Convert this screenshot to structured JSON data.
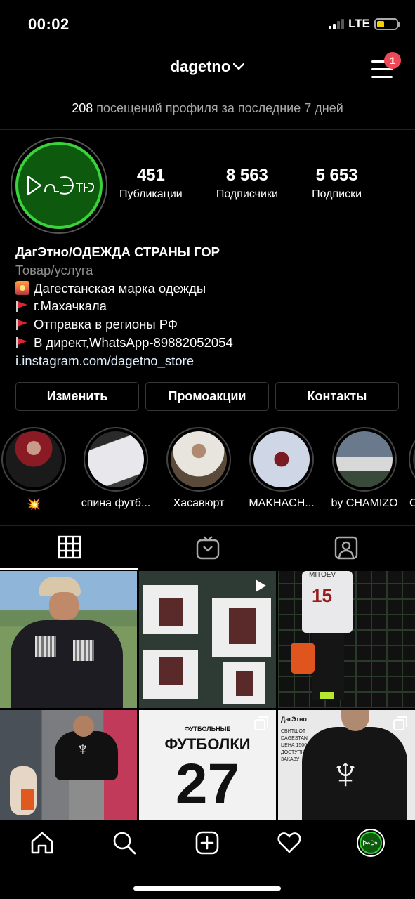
{
  "status_bar": {
    "time": "00:02",
    "network": "LTE"
  },
  "header": {
    "username": "dagetno",
    "notification_count": "1"
  },
  "visits": {
    "count": "208",
    "text": "посещений профиля за последние 7 дней"
  },
  "profile": {
    "avatar_text": "ДагЭтно",
    "stats": [
      {
        "value": "451",
        "label": "Публикации"
      },
      {
        "value": "8 563",
        "label": "Подписчики"
      },
      {
        "value": "5 653",
        "label": "Подписки"
      }
    ],
    "bio": {
      "name": "ДагЭтно/ОДЕЖДА СТРАНЫ ГОР",
      "category": "Товар/услуга",
      "line1": "Дагестанская марка одежды",
      "line2": "г.Махачкала",
      "line3": "Отправка в регионы РФ",
      "line4": "В директ,WhatsApp-89882052054",
      "link": "i.instagram.com/dagetno_store"
    }
  },
  "actions": {
    "edit": "Изменить",
    "promo": "Промоакции",
    "contacts": "Контакты"
  },
  "highlights": [
    {
      "label": "💥"
    },
    {
      "label": "спина футб..."
    },
    {
      "label": "Хасавюрт"
    },
    {
      "label": "MAKHACH..."
    },
    {
      "label": "by CHAMIZO"
    },
    {
      "label": "C"
    }
  ],
  "grid": {
    "post5_small": "ФУТБОЛЬНЫЕ",
    "post5_big": "ФУТБОЛКИ",
    "post5_number": "27",
    "post6_brand": "ДагЭтно",
    "post6_text": "СВИТШОТ DAGESTAN ЦЕНА 1500 ДОСТУПНА К ЗАКАЗУ",
    "post4_jersey": "MITOEV",
    "post4_number": "15"
  },
  "icons": {
    "nav_home": "home-icon",
    "nav_search": "search-icon",
    "nav_add": "add-icon",
    "nav_activity": "heart-icon",
    "nav_profile": "profile-avatar-icon"
  },
  "colors": {
    "accent_green": "#38d43a",
    "notification_red": "#ed4956",
    "background": "#000000"
  }
}
